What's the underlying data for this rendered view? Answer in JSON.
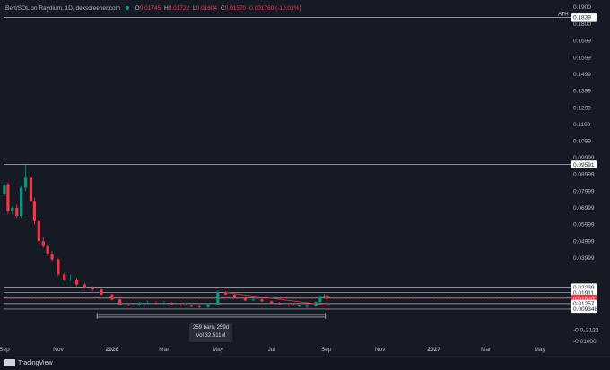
{
  "header": {
    "title": "Bert/SOL on Raydium, 1D, dexscreener.com",
    "open_label": "O",
    "open": "0.01745",
    "high_label": "H",
    "high": "0.01722",
    "low_label": "L",
    "low": "0.01604",
    "close_label": "C",
    "close": "0.01570",
    "change": "-0.001760 (-10.03%)"
  },
  "ath": {
    "label": "ATH",
    "value": "0.1839"
  },
  "price_axis": {
    "ticks": [
      "0.1900",
      "0.1800",
      "0.1699",
      "0.1599",
      "0.1499",
      "0.1399",
      "0.1299",
      "0.1199",
      "0.1099",
      "0.09999",
      "0.08999",
      "0.07999",
      "0.06999",
      "0.05999",
      "0.04999",
      "0.03999",
      "-0.0₀3122",
      "-0.01000"
    ],
    "tick_values": [
      0.19,
      0.18,
      0.1699,
      0.1599,
      0.1499,
      0.1399,
      0.1299,
      0.1199,
      0.1099,
      0.09999,
      0.08999,
      0.07999,
      0.06999,
      0.05999,
      0.04999,
      0.03999,
      -0.003122,
      -0.01
    ]
  },
  "price_tags": [
    {
      "label": "0.1839",
      "value": 0.1839,
      "style": "light"
    },
    {
      "label": "0.09591",
      "value": 0.09591,
      "style": "light"
    },
    {
      "label": "0.02239",
      "value": 0.02239,
      "style": "light"
    },
    {
      "label": "0.01911",
      "value": 0.01911,
      "style": "light"
    },
    {
      "label": "0.01588",
      "value": 0.01588,
      "style": "light"
    },
    {
      "label": "0.01570",
      "value": 0.0157,
      "style": "red"
    },
    {
      "label": "0.01257",
      "value": 0.01257,
      "style": "light"
    },
    {
      "label": "0.009348",
      "value": 0.009348,
      "style": "light"
    }
  ],
  "time_axis": {
    "labels": [
      "Sep",
      "Nov",
      "2026",
      "Mar",
      "May",
      "Jul",
      "Sep",
      "Nov",
      "2027",
      "Mar",
      "May"
    ],
    "bold": [
      false,
      false,
      true,
      false,
      false,
      false,
      false,
      false,
      true,
      false,
      false
    ],
    "dates": [
      "2025-09-01",
      "2025-11-01",
      "2026-01-01",
      "2026-03-01",
      "2026-05-01",
      "2026-07-01",
      "2026-09-01",
      "2026-11-01",
      "2027-01-01",
      "2027-03-01",
      "2027-05-01"
    ]
  },
  "measure": {
    "bars": "259 bars, 259d",
    "volume": "Vol 32.511M"
  },
  "branding": {
    "name": "TradingView"
  },
  "colors": {
    "up": "#089981",
    "down": "#f23645",
    "grid_line": "#d1d4dc"
  },
  "chart_data": {
    "type": "candlestick",
    "title": "Bert/SOL on Raydium, 1D",
    "x_type": "date",
    "ylim": [
      -0.01,
      0.19
    ],
    "xlim": [
      "2025-08-31",
      "2027-06-05"
    ],
    "horizontal_lines": [
      0.1839,
      0.09591,
      0.02239,
      0.01911,
      0.01588,
      0.01257,
      0.009348
    ],
    "trendline": {
      "from": {
        "date": "2026-05-05",
        "value": 0.0195
      },
      "to": {
        "date": "2026-09-03",
        "value": 0.0115
      }
    },
    "series": [
      {
        "dates": [
          "2025-09-01",
          "2025-09-05",
          "2025-09-10",
          "2025-09-15",
          "2025-09-20",
          "2025-09-25",
          "2025-10-01",
          "2025-10-05",
          "2025-10-10",
          "2025-10-15",
          "2025-10-20",
          "2025-10-25",
          "2025-11-01",
          "2025-11-08",
          "2025-11-15",
          "2025-11-22",
          "2025-12-01",
          "2025-12-10",
          "2025-12-20",
          "2026-01-01",
          "2026-01-10",
          "2026-01-20",
          "2026-02-01",
          "2026-02-10",
          "2026-02-20",
          "2026-03-01",
          "2026-03-10",
          "2026-03-20",
          "2026-04-01",
          "2026-04-10",
          "2026-04-20",
          "2026-05-01",
          "2026-05-10",
          "2026-05-20",
          "2026-06-01",
          "2026-06-10",
          "2026-06-20",
          "2026-07-01",
          "2026-07-10",
          "2026-07-20",
          "2026-08-01",
          "2026-08-10",
          "2026-08-20",
          "2026-08-25",
          "2026-08-30",
          "2026-09-02"
        ],
        "open": [
          0.078,
          0.084,
          0.068,
          0.07,
          0.065,
          0.082,
          0.088,
          0.074,
          0.062,
          0.05,
          0.047,
          0.042,
          0.039,
          0.03,
          0.027,
          0.027,
          0.024,
          0.022,
          0.021,
          0.018,
          0.015,
          0.012,
          0.0115,
          0.013,
          0.013,
          0.0125,
          0.013,
          0.012,
          0.0115,
          0.011,
          0.0105,
          0.012,
          0.019,
          0.018,
          0.0165,
          0.0145,
          0.015,
          0.014,
          0.013,
          0.012,
          0.0115,
          0.011,
          0.011,
          0.0135,
          0.017,
          0.0174
        ],
        "high": [
          0.084,
          0.085,
          0.071,
          0.072,
          0.083,
          0.0959,
          0.09,
          0.076,
          0.064,
          0.052,
          0.048,
          0.044,
          0.04,
          0.031,
          0.03,
          0.028,
          0.025,
          0.023,
          0.0215,
          0.0185,
          0.0155,
          0.0125,
          0.0135,
          0.0145,
          0.014,
          0.014,
          0.0135,
          0.0125,
          0.012,
          0.0115,
          0.0125,
          0.0205,
          0.02,
          0.0185,
          0.017,
          0.0155,
          0.0155,
          0.0145,
          0.0135,
          0.0125,
          0.012,
          0.0115,
          0.014,
          0.0175,
          0.0185,
          0.0178
        ],
        "low": [
          0.077,
          0.066,
          0.066,
          0.064,
          0.064,
          0.08,
          0.073,
          0.06,
          0.049,
          0.046,
          0.041,
          0.038,
          0.029,
          0.026,
          0.026,
          0.023,
          0.0215,
          0.02,
          0.0175,
          0.0145,
          0.0118,
          0.011,
          0.011,
          0.0125,
          0.012,
          0.012,
          0.0115,
          0.011,
          0.0105,
          0.01,
          0.01,
          0.0115,
          0.0175,
          0.016,
          0.014,
          0.014,
          0.0135,
          0.0125,
          0.0115,
          0.011,
          0.0105,
          0.01,
          0.0105,
          0.013,
          0.016,
          0.0157
        ],
        "close": [
          0.084,
          0.068,
          0.07,
          0.065,
          0.082,
          0.088,
          0.074,
          0.062,
          0.05,
          0.047,
          0.042,
          0.039,
          0.03,
          0.027,
          0.027,
          0.024,
          0.022,
          0.021,
          0.018,
          0.015,
          0.012,
          0.0115,
          0.013,
          0.013,
          0.0125,
          0.013,
          0.012,
          0.0115,
          0.011,
          0.0105,
          0.012,
          0.019,
          0.018,
          0.0165,
          0.0145,
          0.015,
          0.014,
          0.013,
          0.012,
          0.0115,
          0.011,
          0.011,
          0.0135,
          0.017,
          0.0174,
          0.0157
        ]
      }
    ]
  }
}
